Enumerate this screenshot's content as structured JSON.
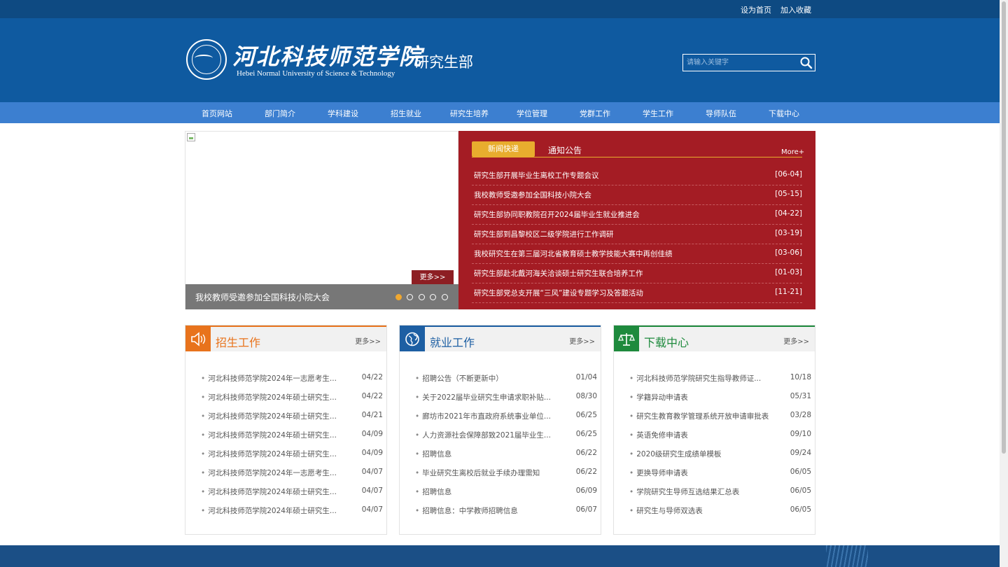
{
  "topbar": {
    "set_home": "设为首页",
    "bookmark": "加入收藏"
  },
  "header": {
    "school_name_cn": "河北科技师范学院",
    "school_name_en": "Hebei Normal University of Science & Technology",
    "department": "研究生部",
    "search_placeholder": "请输入关键字"
  },
  "nav": [
    "首页网站",
    "部门简介",
    "学科建设",
    "招生就业",
    "研究生培养",
    "学位管理",
    "党群工作",
    "学生工作",
    "导师队伍",
    "下载中心"
  ],
  "slider": {
    "caption": "我校教师受邀参加全国科技小院大会",
    "more": "更多>>",
    "dots": 5,
    "active_dot": 0
  },
  "news": {
    "tab_active": "新闻快递",
    "tab_other": "通知公告",
    "more": "More+",
    "items": [
      {
        "title": "研究生部开展毕业生离校工作专题会议",
        "date": "[06-04]"
      },
      {
        "title": "我校教师受邀参加全国科技小院大会",
        "date": "[05-15]"
      },
      {
        "title": "研究生部协同职教院召开2024届毕业生就业推进会",
        "date": "[04-22]"
      },
      {
        "title": "研究生部到昌黎校区二级学院进行工作调研",
        "date": "[03-19]"
      },
      {
        "title": "我校研究生在第三届河北省教育硕士教学技能大赛中再创佳绩",
        "date": "[03-06]"
      },
      {
        "title": "研究生部赴北戴河海关洽谈硕士研究生联合培养工作",
        "date": "[01-03]"
      },
      {
        "title": "研究生部党总支开展“三风”建设专题学习及答题活动",
        "date": "[11-21]"
      }
    ]
  },
  "boxes": [
    {
      "title": "招生工作",
      "more": "更多>>",
      "color": "#e8731c",
      "icon": "speaker-icon",
      "items": [
        {
          "title": "河北科技师范学院2024年一志愿考生...",
          "date": "04/22"
        },
        {
          "title": "河北科技师范学院2024年硕士研究生...",
          "date": "04/22"
        },
        {
          "title": "河北科技师范学院2024年硕士研究生...",
          "date": "04/21"
        },
        {
          "title": "河北科技师范学院2024年硕士研究生...",
          "date": "04/09"
        },
        {
          "title": "河北科技师范学院2024年硕士研究生...",
          "date": "04/09"
        },
        {
          "title": "河北科技师范学院2024年一志愿考生...",
          "date": "04/07"
        },
        {
          "title": "河北科技师范学院2024年硕士研究生...",
          "date": "04/07"
        },
        {
          "title": "河北科技师范学院2024年硕士研究生...",
          "date": "04/07"
        }
      ]
    },
    {
      "title": "就业工作",
      "more": "更多>>",
      "color": "#1d5fa3",
      "icon": "globe-icon",
      "items": [
        {
          "title": "招聘公告（不断更新中）",
          "date": "01/04"
        },
        {
          "title": "关于2022届毕业研究生申请求职补贴...",
          "date": "08/30"
        },
        {
          "title": "廊坊市2021年市直政府系统事业单位...",
          "date": "06/25"
        },
        {
          "title": "人力资源社会保障部致2021届毕业生...",
          "date": "06/25"
        },
        {
          "title": "招聘信息",
          "date": "06/22"
        },
        {
          "title": "毕业研究生离校后就业手续办理需知",
          "date": "06/22"
        },
        {
          "title": "招聘信息",
          "date": "06/09"
        },
        {
          "title": "招聘信息：中学教师招聘信息",
          "date": "06/07"
        }
      ]
    },
    {
      "title": "下载中心",
      "more": "更多>>",
      "color": "#1e8a3d",
      "icon": "scales-icon",
      "items": [
        {
          "title": "河北科技师范学院研究生指导教师证...",
          "date": "10/18"
        },
        {
          "title": "学籍异动申请表",
          "date": "05/31"
        },
        {
          "title": "研究生教育教学管理系统开放申请审批表",
          "date": "03/28"
        },
        {
          "title": "英语免修申请表",
          "date": "09/10"
        },
        {
          "title": "2020级研究生成绩单模板",
          "date": "09/24"
        },
        {
          "title": "更换导师申请表",
          "date": "06/05"
        },
        {
          "title": "学院研究生导师互选结果汇总表",
          "date": "06/05"
        },
        {
          "title": "研究生与导师双选表",
          "date": "06/05"
        }
      ]
    }
  ]
}
